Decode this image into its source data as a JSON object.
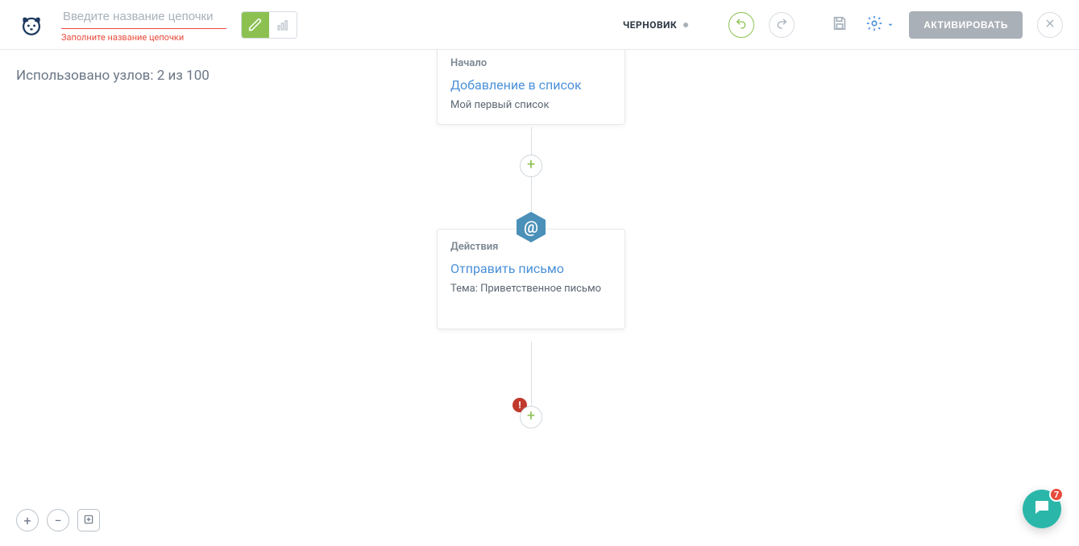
{
  "header": {
    "name_placeholder": "Введите название цепочки",
    "name_error": "Заполните название цепочки",
    "status_label": "ЧЕРНОВИК",
    "activate_label": "АКТИВИРОВАТЬ"
  },
  "canvas": {
    "usage_text": "Использовано узлов: 2 из 100"
  },
  "nodes": {
    "start": {
      "category": "Начало",
      "title": "Добавление в список",
      "subtitle": "Мой первый список"
    },
    "action": {
      "category": "Действия",
      "title": "Отправить письмо",
      "subtitle": "Тема: Приветственное письмо"
    }
  },
  "chat": {
    "badge_count": "7"
  }
}
